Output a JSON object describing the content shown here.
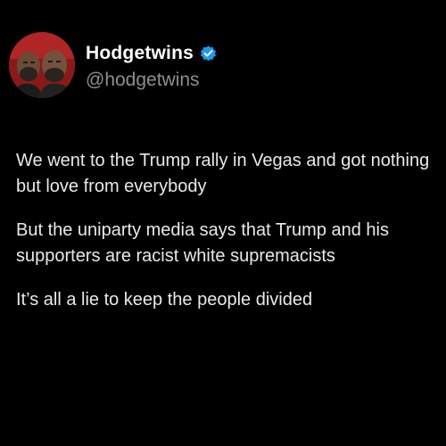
{
  "account": {
    "display_name": "Hodgetwins",
    "handle": "@hodgetwins",
    "verified": true,
    "verified_badge_color": "#1d9bf0",
    "avatar_background_color": "#8a1a1a"
  },
  "tweet": {
    "paragraphs": [
      "We went to the Trump rally in Vegas and got nothing but love from everybody",
      "But the uniparty media says that Trump and his supporters are racist white supremacists",
      "It’s all a lie to keep the people divided"
    ]
  },
  "colors": {
    "background": "#000000",
    "text": "#e7e9ea",
    "secondary_text": "#8b8f94"
  }
}
